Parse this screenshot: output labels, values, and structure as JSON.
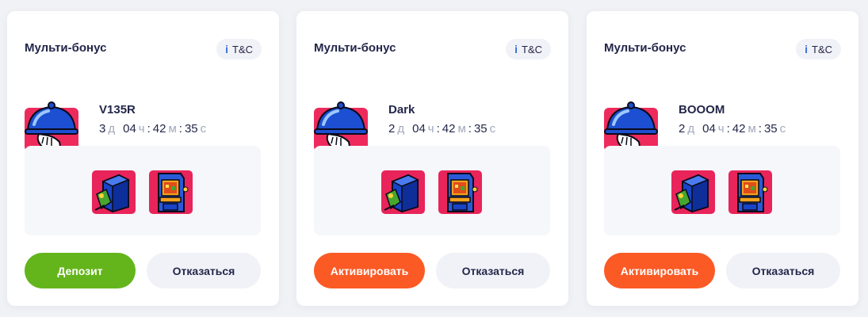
{
  "cards": [
    {
      "title": "Мульти-бонус",
      "tc_icon": "i",
      "tc_label": "T&C",
      "avatar_icon": "waiter-cloche-icon",
      "name": "V135R",
      "timer": {
        "d": "3",
        "d_unit": "д",
        "h": "04",
        "h_unit": "ч",
        "m": "42",
        "m_unit": "м",
        "s": "35",
        "s_unit": "с"
      },
      "games": [
        "slot-cabinet-blue-icon",
        "arcade-cabinet-icon"
      ],
      "primary_label": "Депозит",
      "primary_color": "#64b51b",
      "secondary_label": "Отказаться"
    },
    {
      "title": "Мульти-бонус",
      "tc_icon": "i",
      "tc_label": "T&C",
      "avatar_icon": "waiter-cloche-icon",
      "name": "Dark",
      "timer": {
        "d": "2",
        "d_unit": "д",
        "h": "04",
        "h_unit": "ч",
        "m": "42",
        "m_unit": "м",
        "s": "35",
        "s_unit": "с"
      },
      "games": [
        "slot-cabinet-blue-icon",
        "arcade-cabinet-icon"
      ],
      "primary_label": "Активировать",
      "primary_color": "#fb5a25",
      "secondary_label": "Отказаться"
    },
    {
      "title": "Мульти-бонус",
      "tc_icon": "i",
      "tc_label": "T&C",
      "avatar_icon": "waiter-cloche-icon",
      "name": "BOOOM",
      "timer": {
        "d": "2",
        "d_unit": "д",
        "h": "04",
        "h_unit": "ч",
        "m": "42",
        "m_unit": "м",
        "s": "35",
        "s_unit": "с"
      },
      "games": [
        "slot-cabinet-blue-icon",
        "arcade-cabinet-icon"
      ],
      "primary_label": "Активировать",
      "primary_color": "#fb5a25",
      "secondary_label": "Отказаться"
    }
  ]
}
